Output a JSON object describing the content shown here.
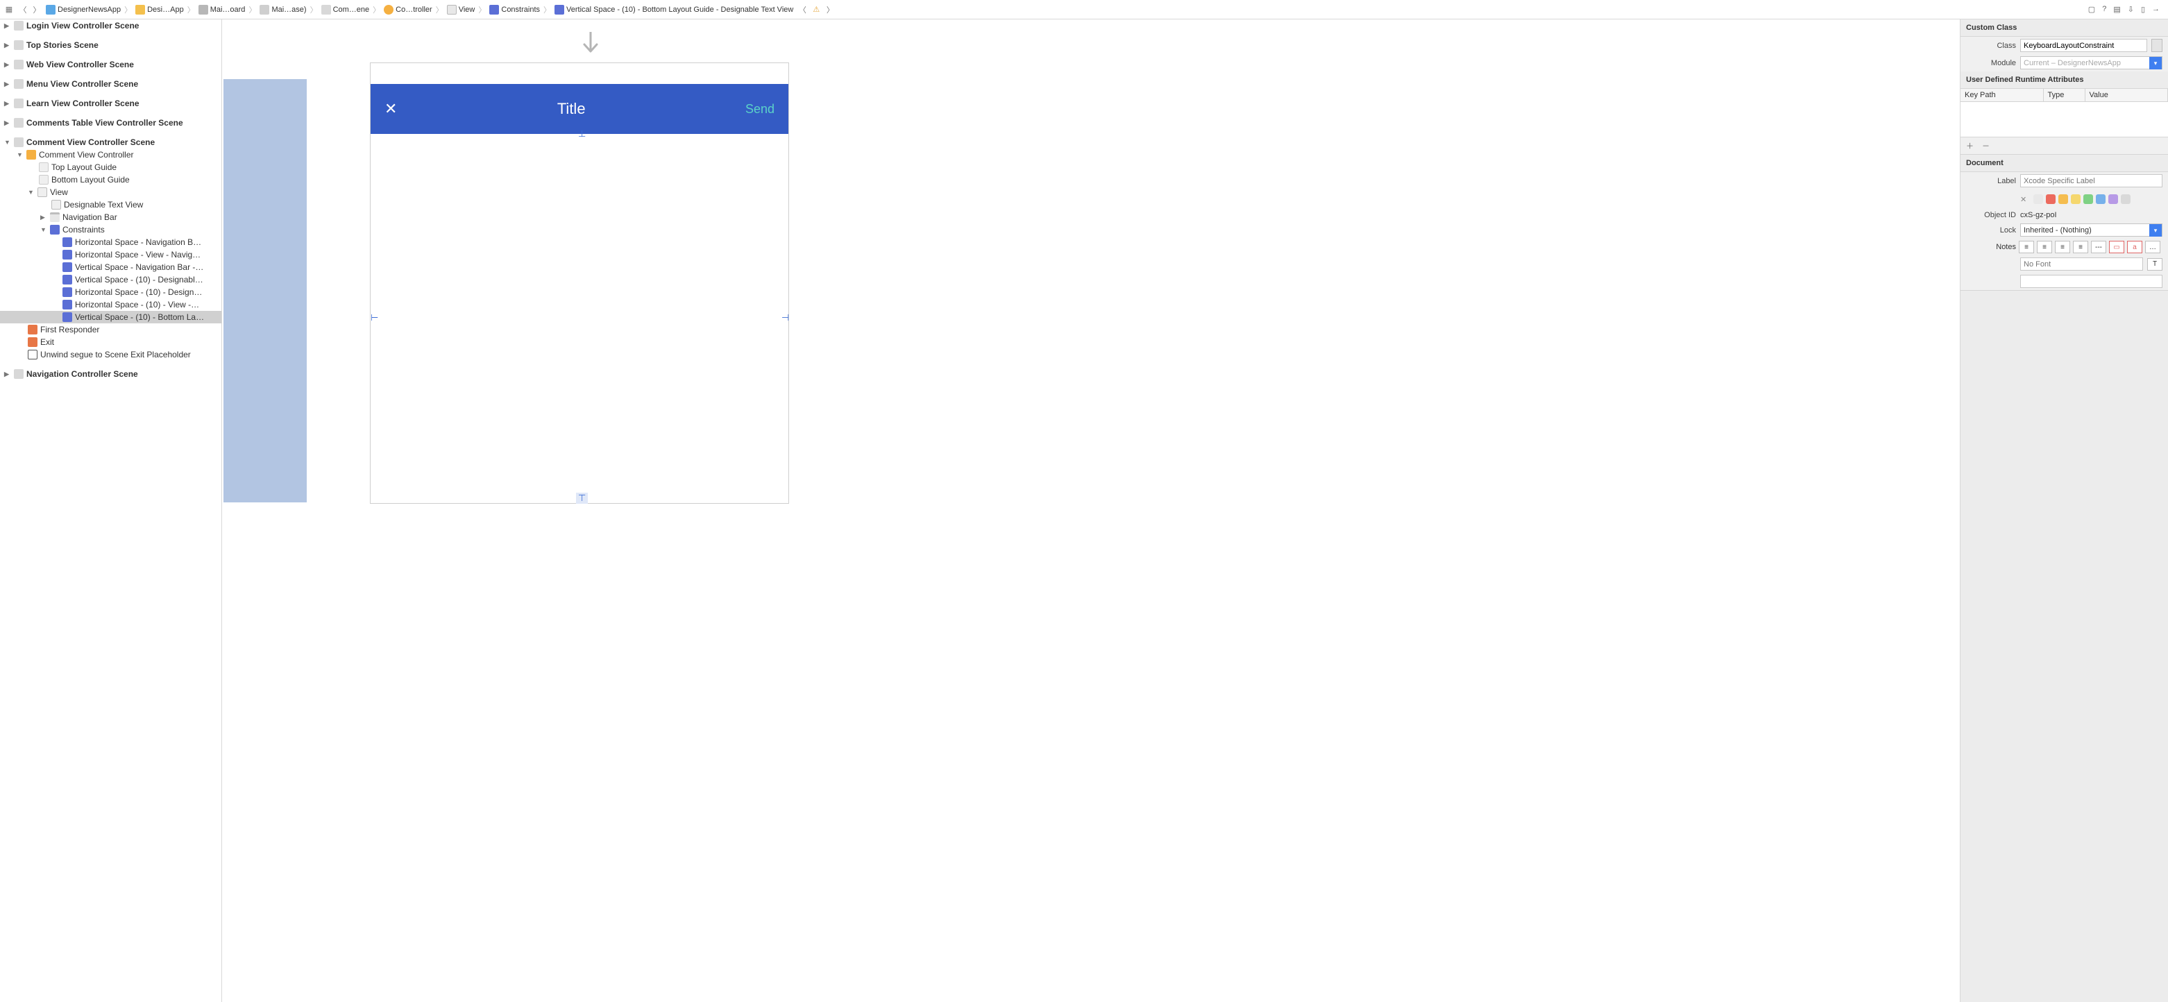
{
  "breadcrumb": {
    "items": [
      {
        "label": "DesignerNewsApp",
        "icon": "proj"
      },
      {
        "label": "Desi…App",
        "icon": "folder"
      },
      {
        "label": "Mai…oard",
        "icon": "storyboard"
      },
      {
        "label": "Mai…ase)",
        "icon": "base"
      },
      {
        "label": "Com…ene",
        "icon": "scene"
      },
      {
        "label": "Co…troller",
        "icon": "ctrl"
      },
      {
        "label": "View",
        "icon": "view"
      },
      {
        "label": "Constraints",
        "icon": "constraint"
      },
      {
        "label": "Vertical Space - (10) - Bottom Layout Guide - Designable Text View",
        "icon": "constraint"
      }
    ]
  },
  "outline": {
    "scenes": [
      "Login View Controller Scene",
      "Top Stories Scene",
      "Web View Controller Scene",
      "Menu View Controller Scene",
      "Learn View Controller Scene",
      "Comments Table View Controller Scene"
    ],
    "expanded_scene": "Comment View Controller Scene",
    "vc": "Comment View Controller",
    "top_guide": "Top Layout Guide",
    "bottom_guide": "Bottom Layout Guide",
    "view": "View",
    "text_view": "Designable Text View",
    "nav_bar": "Navigation Bar",
    "constraints_label": "Constraints",
    "constraints": [
      "Horizontal Space - Navigation B…",
      "Horizontal Space - View - Navig…",
      "Vertical Space - Navigation Bar -…",
      "Vertical Space - (10) - Designabl…",
      "Horizontal Space - (10) - Design…",
      "Horizontal Space - (10) - View -…",
      "Vertical Space - (10) - Bottom La…"
    ],
    "selected_constraint_index": 6,
    "first_responder": "First Responder",
    "exit": "Exit",
    "unwind": "Unwind segue to Scene Exit Placeholder",
    "last_scene": "Navigation Controller Scene"
  },
  "canvas": {
    "nav_title": "Title",
    "nav_send": "Send"
  },
  "inspector": {
    "custom_class_section": "Custom Class",
    "class_label": "Class",
    "class_value": "KeyboardLayoutConstraint",
    "module_label": "Module",
    "module_placeholder": "Current – DesignerNewsApp",
    "runtime_attrs_section": "User Defined Runtime Attributes",
    "col_keypath": "Key Path",
    "col_type": "Type",
    "col_value": "Value",
    "document_section": "Document",
    "label_label": "Label",
    "label_placeholder": "Xcode Specific Label",
    "object_id_label": "Object ID",
    "object_id_value": "cxS-gz-poI",
    "lock_label": "Lock",
    "lock_value": "Inherited - (Nothing)",
    "notes_label": "Notes",
    "font_placeholder": "No Font",
    "swatch_colors": [
      "#e8e8e8",
      "#ec6a5e",
      "#f5bd4f",
      "#f5d76e",
      "#7fd184",
      "#76b0ea",
      "#b79ae6",
      "#d9d9d9"
    ]
  }
}
